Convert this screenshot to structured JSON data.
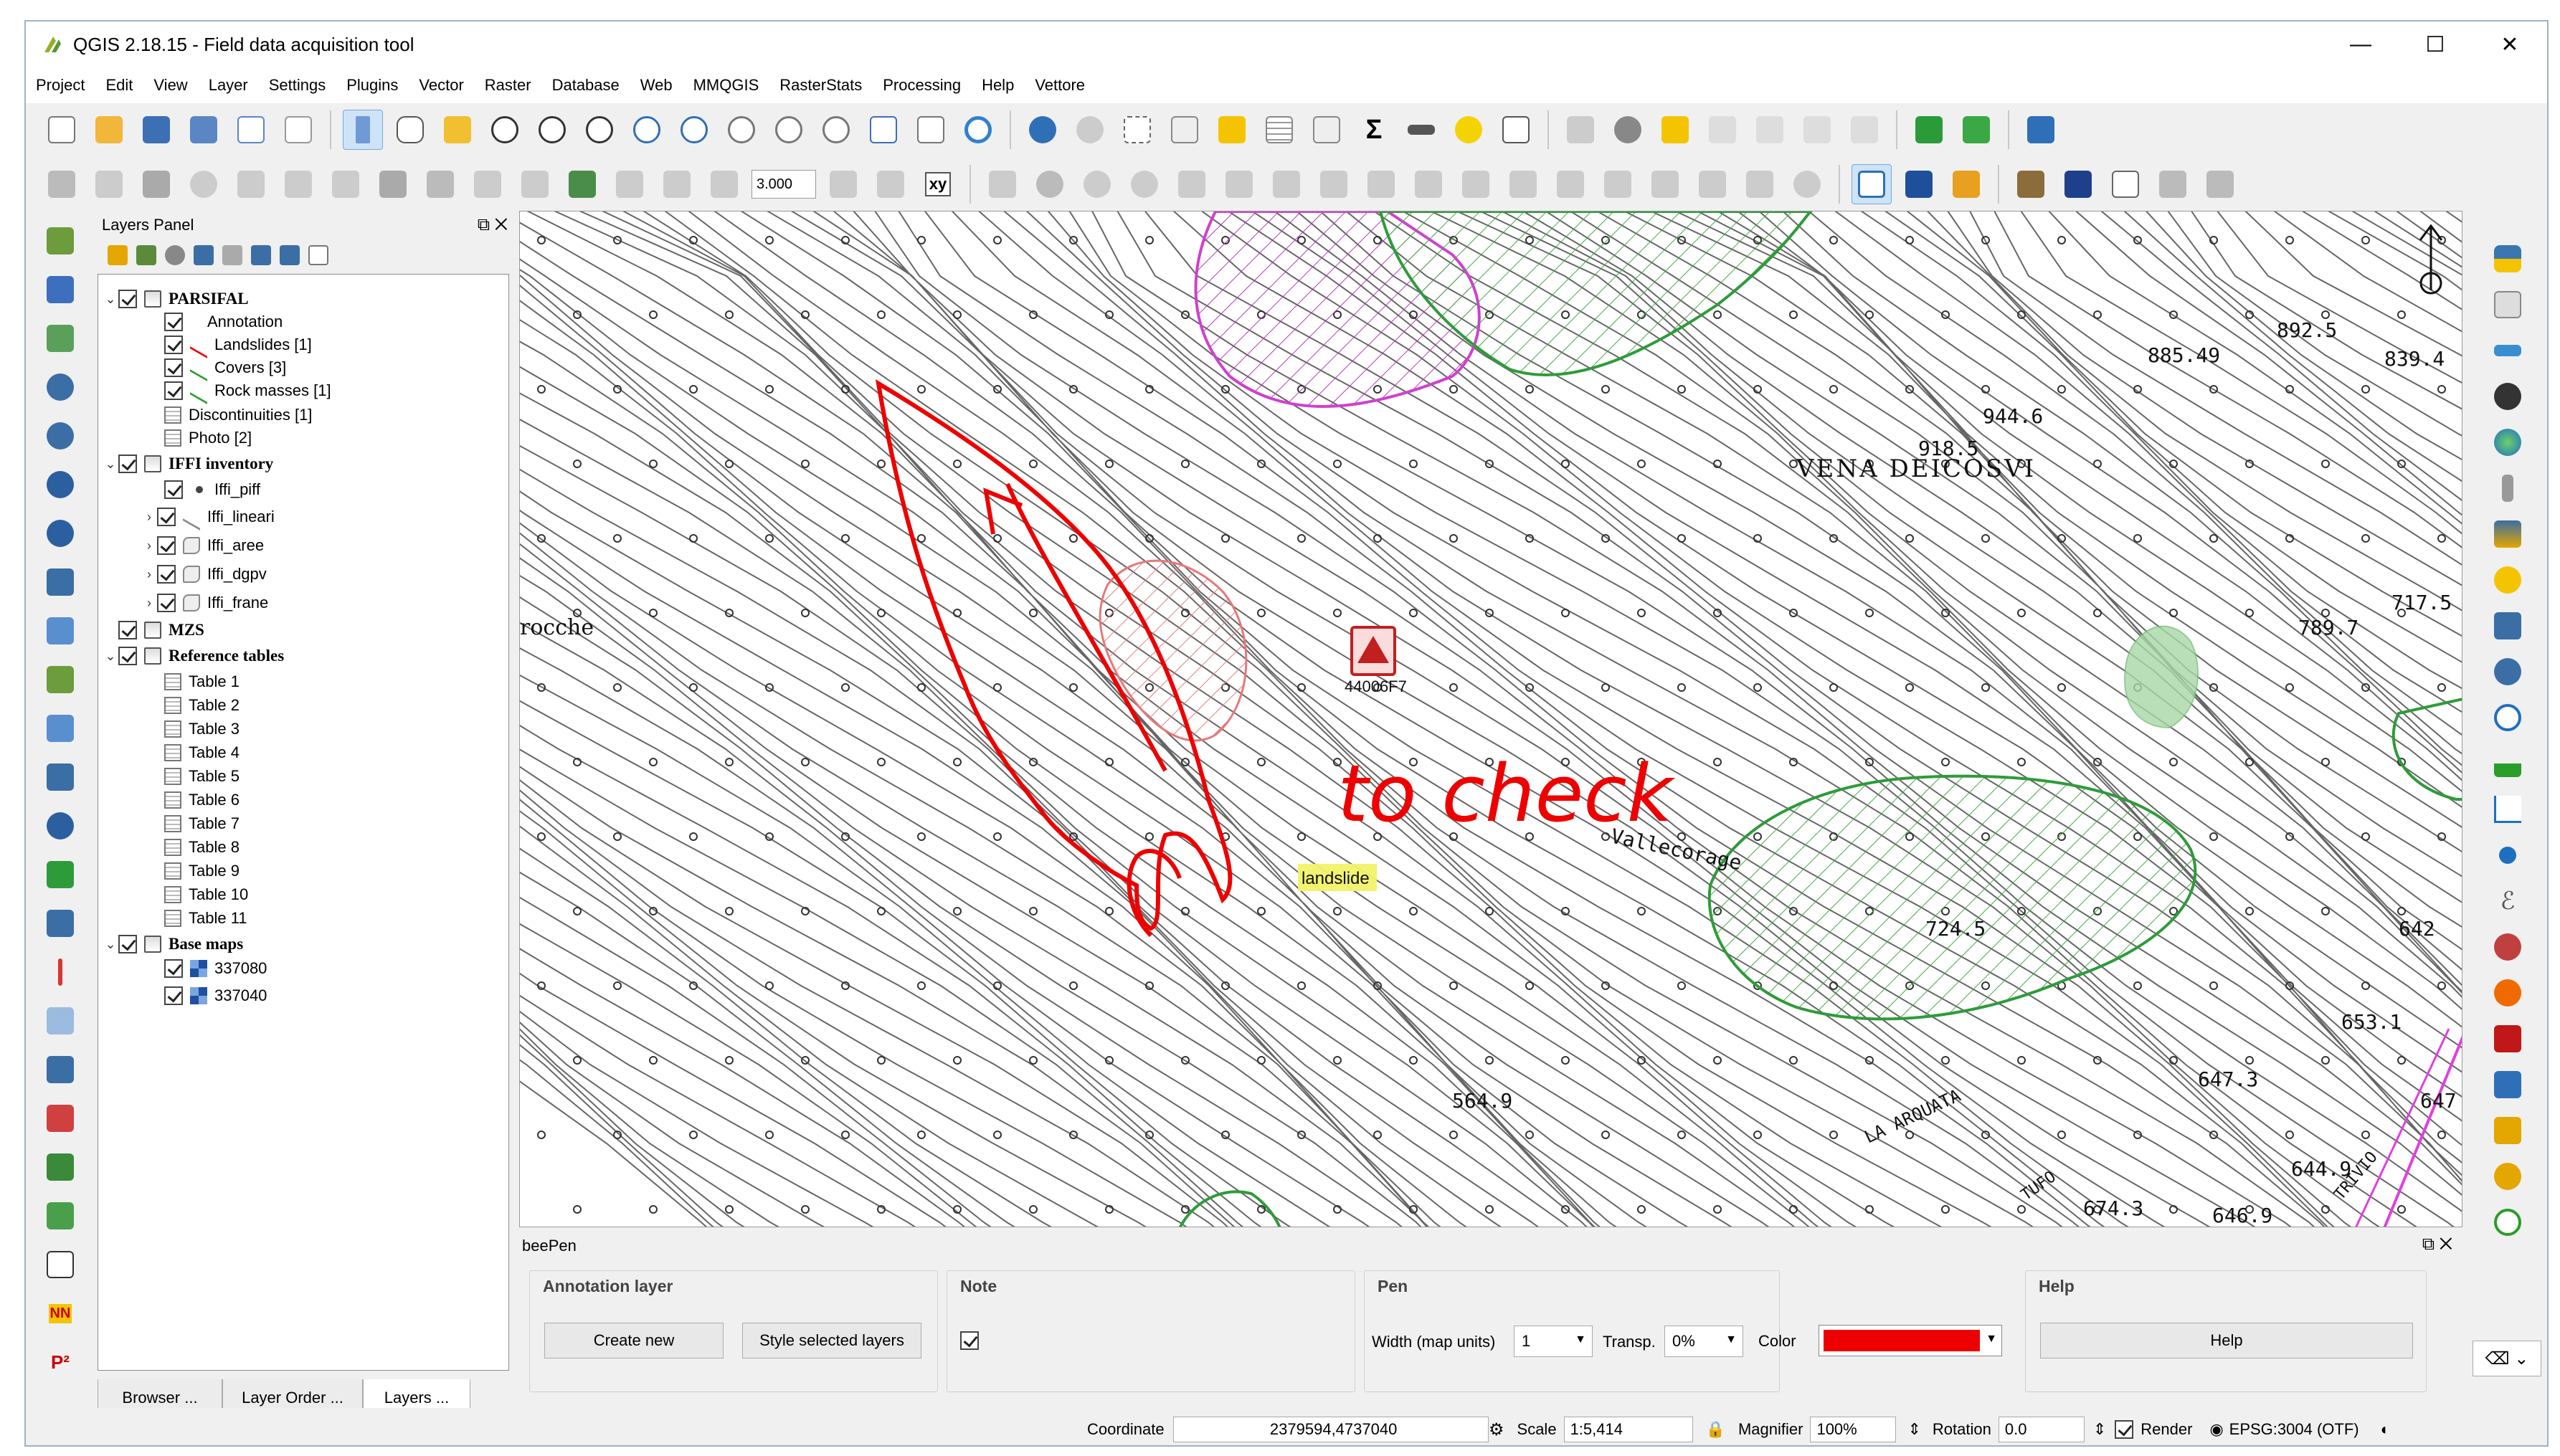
{
  "window": {
    "title": "QGIS 2.18.15 - Field data acquisition tool",
    "controls": {
      "minimize": "—",
      "maximize": "☐",
      "close": "✕"
    }
  },
  "menu": [
    "Project",
    "Edit",
    "View",
    "Layer",
    "Settings",
    "Plugins",
    "Vector",
    "Raster",
    "Database",
    "Web",
    "MMQGIS",
    "RasterStats",
    "Processing",
    "Help",
    "Vettore"
  ],
  "toolbar2": {
    "spin_value": "3.000",
    "xy_label": "xy"
  },
  "layers_panel": {
    "title": "Layers Panel",
    "tree": [
      {
        "label": "PARSIFAL",
        "kind": "group"
      },
      {
        "label": "Annotation",
        "kind": "layer"
      },
      {
        "label": "Landslides [1]",
        "kind": "layer"
      },
      {
        "label": "Covers [3]",
        "kind": "layer"
      },
      {
        "label": "Rock masses [1]",
        "kind": "layer"
      },
      {
        "label": "Discontinuities [1]",
        "kind": "table"
      },
      {
        "label": "Photo [2]",
        "kind": "table"
      },
      {
        "label": "IFFI inventory",
        "kind": "group"
      },
      {
        "label": "Iffi_piff",
        "kind": "layer"
      },
      {
        "label": "Iffi_lineari",
        "kind": "layer"
      },
      {
        "label": "Iffi_aree",
        "kind": "layer"
      },
      {
        "label": "Iffi_dgpv",
        "kind": "layer"
      },
      {
        "label": "Iffi_frane",
        "kind": "layer"
      },
      {
        "label": "MZS",
        "kind": "group"
      },
      {
        "label": "Reference tables",
        "kind": "group"
      },
      {
        "label": "Table 1",
        "kind": "table"
      },
      {
        "label": "Table 2",
        "kind": "table"
      },
      {
        "label": "Table 3",
        "kind": "table"
      },
      {
        "label": "Table 4",
        "kind": "table"
      },
      {
        "label": "Table 5",
        "kind": "table"
      },
      {
        "label": "Table 6",
        "kind": "table"
      },
      {
        "label": "Table 7",
        "kind": "table"
      },
      {
        "label": "Table 8",
        "kind": "table"
      },
      {
        "label": "Table 9",
        "kind": "table"
      },
      {
        "label": "Table 10",
        "kind": "table"
      },
      {
        "label": "Table 11",
        "kind": "table"
      },
      {
        "label": "Base maps",
        "kind": "group"
      },
      {
        "label": "337080",
        "kind": "raster"
      },
      {
        "label": "337040",
        "kind": "raster"
      }
    ],
    "tabs": [
      "Browser ...",
      "Layer Order ...",
      "Layers ..."
    ]
  },
  "map": {
    "labels": {
      "vena": "VENA DEICOSVI",
      "rocche": "rocche",
      "valle": "Vallecorage",
      "point_id": "44006F7",
      "landslide_tag": "landslide",
      "annotation": "to check",
      "el_885": "885.49",
      "el_892": "892.5",
      "el_839": "839.4",
      "el_944": "944.6",
      "el_918": "918.5",
      "el_789": "789.7",
      "el_717": "717.5",
      "el_724": "724.5",
      "el_642": "642",
      "el_653": "653.1",
      "el_647a": "647.3",
      "el_647b": "647",
      "el_644": "644.9",
      "el_674": "674.3",
      "el_646": "646.9",
      "el_564": "564.9",
      "arqua": "LA ARQUATA",
      "tufo": "TUFO",
      "trivio": "TRIVIO"
    }
  },
  "beepen": {
    "title": "beePen",
    "annotation_layer": {
      "title": "Annotation layer",
      "create_new": "Create new",
      "style_selected": "Style selected layers"
    },
    "note": {
      "title": "Note",
      "checked": true
    },
    "pen": {
      "title": "Pen",
      "width_label": "Width (map units)",
      "width_value": "1",
      "transp_label": "Transp.",
      "transp_value": "0%",
      "color_label": "Color",
      "color_value": "#ee0000"
    },
    "help": {
      "title": "Help",
      "button": "Help"
    }
  },
  "statusbar": {
    "coordinate_label": "Coordinate",
    "coordinate_value": "2379594,4737040",
    "scale_label": "Scale",
    "scale_value": "1:5,414",
    "magnifier_label": "Magnifier",
    "magnifier_value": "100%",
    "rotation_label": "Rotation",
    "rotation_value": "0.0",
    "render_label": "Render",
    "crs": "EPSG:3004 (OTF)"
  }
}
